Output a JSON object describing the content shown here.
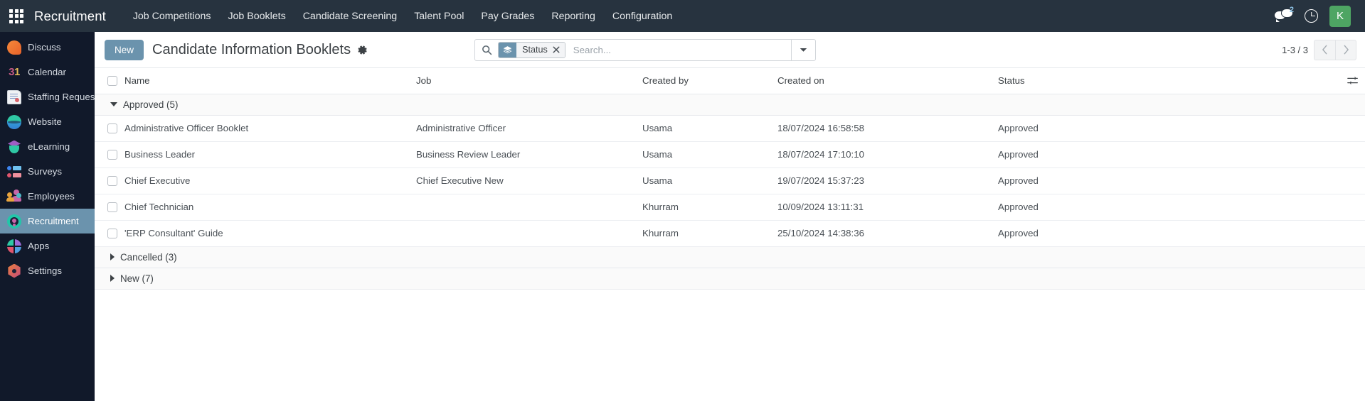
{
  "navbar": {
    "apps_icon": "apps-grid-icon",
    "brand": "Recruitment",
    "menu": [
      {
        "label": "Job Competitions"
      },
      {
        "label": "Job Booklets"
      },
      {
        "label": "Candidate Screening"
      },
      {
        "label": "Talent Pool"
      },
      {
        "label": "Pay Grades"
      },
      {
        "label": "Reporting"
      },
      {
        "label": "Configuration"
      }
    ],
    "messages_icon": "messages-icon",
    "messages_count": "2",
    "activity_icon": "clock-icon",
    "avatar_initial": "K",
    "avatar_color": "#4ea563"
  },
  "sidebar": {
    "items": [
      {
        "label": "Discuss",
        "icon": "discuss-icon",
        "active": false
      },
      {
        "label": "Calendar",
        "icon": "calendar-icon",
        "active": false
      },
      {
        "label": "Staffing Requests",
        "icon": "staffing-requests-icon",
        "active": false
      },
      {
        "label": "Website",
        "icon": "website-icon",
        "active": false
      },
      {
        "label": "eLearning",
        "icon": "elearning-icon",
        "active": false
      },
      {
        "label": "Surveys",
        "icon": "surveys-icon",
        "active": false
      },
      {
        "label": "Employees",
        "icon": "employees-icon",
        "active": false
      },
      {
        "label": "Recruitment",
        "icon": "recruitment-icon",
        "active": true
      },
      {
        "label": "Apps",
        "icon": "apps-icon",
        "active": false
      },
      {
        "label": "Settings",
        "icon": "settings-icon",
        "active": false
      }
    ],
    "active_bg": "#6b93ad"
  },
  "control_panel": {
    "new_button": "New",
    "title": "Candidate Information Booklets",
    "gear_icon": "gear-icon",
    "search": {
      "search_icon": "search-icon",
      "facet_icon": "layers-icon",
      "facet_label": "Status",
      "facet_remove_icon": "close-icon",
      "placeholder": "Search...",
      "value": "",
      "toggle_icon": "chevron-down-icon"
    },
    "pager": {
      "range": "1-3 / 3",
      "prev_icon": "chevron-left-icon",
      "next_icon": "chevron-right-icon"
    }
  },
  "table": {
    "select_all_checkbox": "select-all-checkbox",
    "optional_columns_icon": "optional-columns-icon",
    "columns": [
      {
        "key": "name",
        "label": "Name"
      },
      {
        "key": "job",
        "label": "Job"
      },
      {
        "key": "created_by",
        "label": "Created by"
      },
      {
        "key": "created_on",
        "label": "Created on"
      },
      {
        "key": "status",
        "label": "Status"
      }
    ],
    "groups": [
      {
        "label": "Approved (5)",
        "expanded": true,
        "rows": [
          {
            "name": "Administrative Officer Booklet",
            "job": "Administrative Officer",
            "created_by": "Usama",
            "created_on": "18/07/2024 16:58:58",
            "status": "Approved"
          },
          {
            "name": "Business Leader",
            "job": "Business Review Leader",
            "created_by": "Usama",
            "created_on": "18/07/2024 17:10:10",
            "status": "Approved"
          },
          {
            "name": "Chief Executive",
            "job": "Chief Executive New",
            "created_by": "Usama",
            "created_on": "19/07/2024 15:37:23",
            "status": "Approved"
          },
          {
            "name": "Chief Technician",
            "job": "",
            "created_by": "Khurram",
            "created_on": "10/09/2024 13:11:31",
            "status": "Approved"
          },
          {
            "name": "'ERP Consultant' Guide",
            "job": "",
            "created_by": "Khurram",
            "created_on": "25/10/2024 14:38:36",
            "status": "Approved"
          }
        ]
      },
      {
        "label": "Cancelled (3)",
        "expanded": false,
        "rows": []
      },
      {
        "label": "New (7)",
        "expanded": false,
        "rows": []
      }
    ]
  }
}
